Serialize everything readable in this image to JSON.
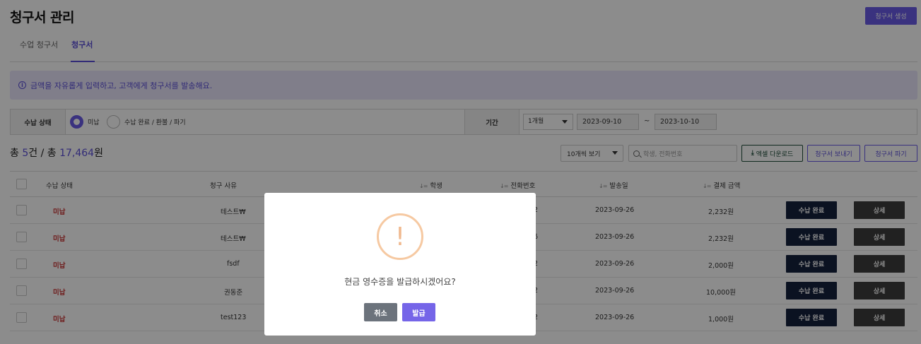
{
  "header": {
    "title": "청구서 관리",
    "create_label": "청구서 생성"
  },
  "tabs": [
    {
      "label": "수업 청구서"
    },
    {
      "label": "청구서"
    }
  ],
  "notice": {
    "icon": "info-icon",
    "text": "금액을 자유롭게 입력하고, 고객에게 청구서를 발송해요."
  },
  "filter": {
    "status_label": "수납 상태",
    "options": [
      {
        "label": "미납",
        "selected": true
      },
      {
        "label": "수납 완료 / 환불 / 파기",
        "selected": false
      }
    ],
    "period_label": "기간",
    "period_select": "1개월",
    "date_from": "2023-09-10",
    "date_sep": "~",
    "date_to": "2023-10-10"
  },
  "summary": {
    "prefix": "총 ",
    "count": "5",
    "count_unit": "건 / 총 ",
    "amount": "17,464",
    "amount_unit": "원"
  },
  "toolbar": {
    "per_page": "10개씩 보기",
    "search_placeholder": "학생, 전화번호",
    "excel_label": "엑셀 다운로드",
    "send_label": "청구서 보내기",
    "destroy_label": "청구서 파기"
  },
  "table": {
    "columns": [
      "수납 상태",
      "청구 사유",
      "학생",
      "전화번호",
      "발송일",
      "결제 금액"
    ],
    "rows": [
      {
        "status": "미납",
        "reason": "테스트₩",
        "phone": "42",
        "sent": "2023-09-26",
        "amount": "2,232원"
      },
      {
        "status": "미납",
        "reason": "테스트₩",
        "phone": "96",
        "sent": "2023-09-26",
        "amount": "2,232원"
      },
      {
        "status": "미납",
        "reason": "fsdf",
        "phone": "42",
        "sent": "2023-09-26",
        "amount": "2,000원"
      },
      {
        "status": "미납",
        "reason": "권동준",
        "phone": "42",
        "sent": "2023-09-26",
        "amount": "10,000원"
      },
      {
        "status": "미납",
        "reason": "test123",
        "phone": "42",
        "sent": "2023-09-26",
        "amount": "1,000원"
      }
    ],
    "done_label": "수납 완료",
    "detail_label": "상세"
  },
  "modal": {
    "icon": "warning-icon",
    "glyph": "!",
    "message": "현금 영수증을 발급하시겠어요?",
    "cancel_label": "취소",
    "confirm_label": "발급"
  }
}
